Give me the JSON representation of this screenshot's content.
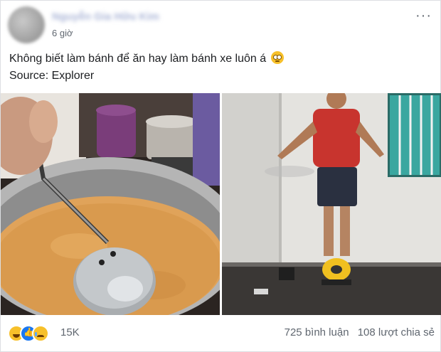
{
  "post": {
    "author": "Nguyễn Gia Hữu Kim",
    "time": "6 giờ",
    "more_icon": "···",
    "caption_line1": "Không biết làm bánh để ăn hay làm bánh xe luôn á",
    "caption_line2": "Source: Explorer"
  },
  "footer": {
    "reaction_count": "15K",
    "comments": "725 bình luận",
    "shares": "108 lượt chia sẻ"
  }
}
